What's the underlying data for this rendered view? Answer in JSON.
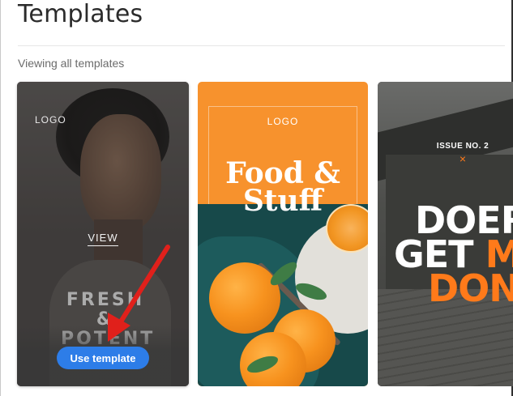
{
  "page": {
    "title": "Templates",
    "subtitle": "Viewing all templates"
  },
  "cards": [
    {
      "logo": "LOGO",
      "view_label": "VIEW",
      "poster_text": "FRESH & POTENT",
      "button_label": "Use template"
    },
    {
      "logo": "LOGO",
      "title_line1": "Food &",
      "title_line2": "Stuff"
    },
    {
      "issue": "ISSUE NO. 2",
      "mark": "×",
      "headline_line1": "DOERS",
      "headline_line2a": "GET ",
      "headline_line2b": "MORE",
      "headline_line3": "DONE"
    }
  ],
  "colors": {
    "button": "#2d7de8",
    "accent_orange": "#ff7a1a",
    "card2_bg": "#f7922d",
    "annotation_arrow": "#e0201b"
  }
}
